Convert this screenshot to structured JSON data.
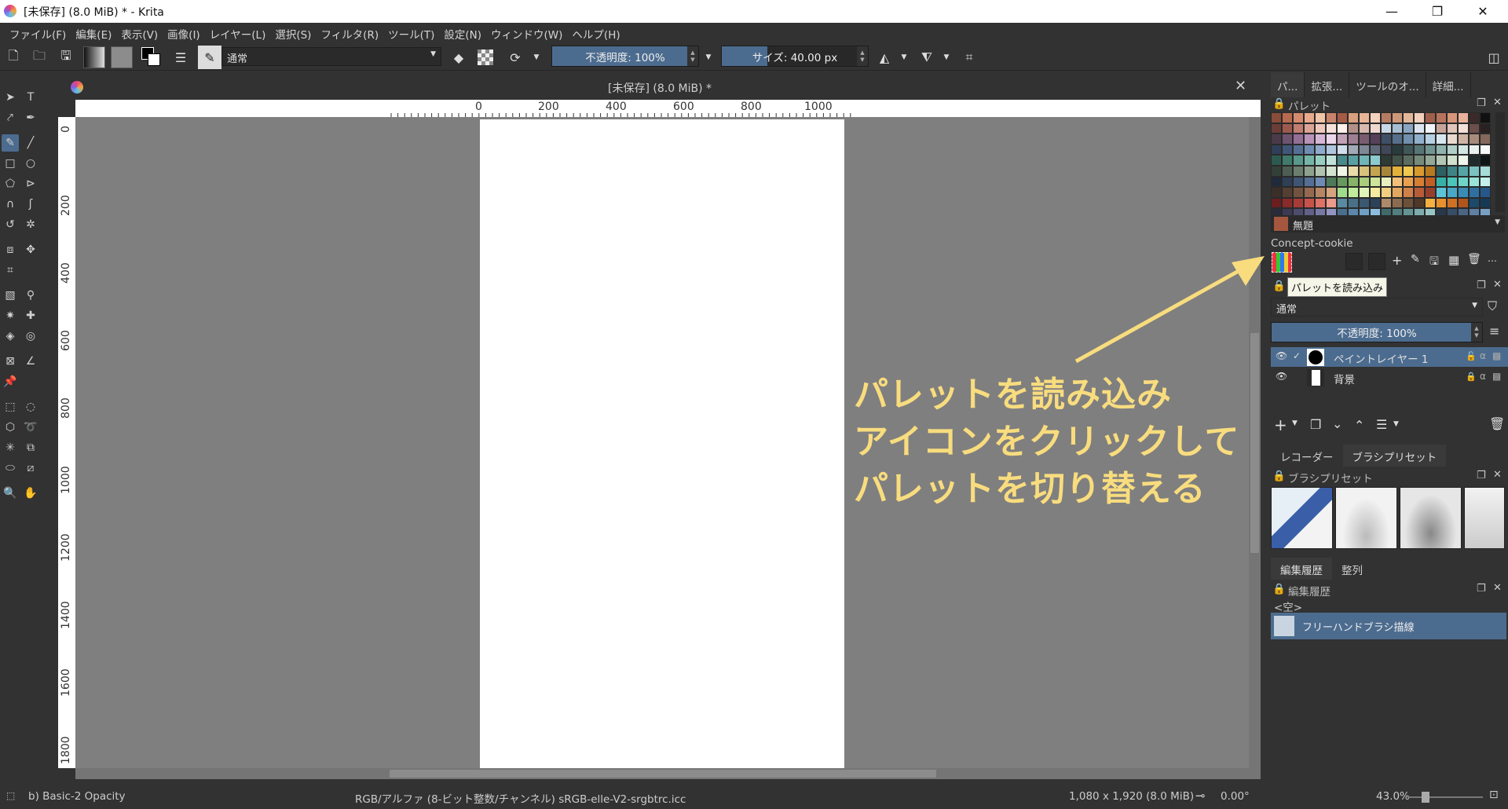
{
  "window": {
    "title": "[未保存]  (8.0 MiB) * - Krita",
    "minimize": "—",
    "maximize": "❐",
    "close": "✕"
  },
  "menu": [
    "ファイル(F)",
    "編集(E)",
    "表示(V)",
    "画像(I)",
    "レイヤー(L)",
    "選択(S)",
    "フィルタ(R)",
    "ツール(T)",
    "設定(N)",
    "ウィンドウ(W)",
    "ヘルプ(H)"
  ],
  "toolbar": {
    "blend_mode": "通常",
    "opacity": "不透明度: 100%",
    "size": "サイズ: 40.00 px"
  },
  "document": {
    "tab_title": "[未保存]  (8.0 MiB) *",
    "close": "✕"
  },
  "ruler": {
    "top": [
      "0",
      "200",
      "400",
      "600",
      "800",
      "1000"
    ],
    "left": [
      "0",
      "200",
      "400",
      "600",
      "800",
      "1000",
      "1200",
      "1400",
      "1600",
      "1800"
    ]
  },
  "annotation": {
    "line1": "パレットを読み込み",
    "line2": "アイコンをクリックして",
    "line3": "パレットを切り替える",
    "color": "#f8dc7e"
  },
  "dock": {
    "tabs": [
      "パ...",
      "拡張...",
      "ツールのオ...",
      "詳細..."
    ],
    "palette": {
      "title": "パレット",
      "selected_color_name": "無題",
      "palette_name": "Concept-cookie",
      "tooltip": "パレットを読み込み"
    },
    "layers": {
      "blend_mode": "通常",
      "opacity": "不透明度:  100%",
      "items": [
        {
          "name": "ペイントレイヤー 1"
        },
        {
          "name": "背景"
        }
      ]
    },
    "lower_tabs": [
      "レコーダー",
      "ブラシプリセット"
    ],
    "brush_presets": {
      "title": "ブラシプリセット"
    },
    "history_tabs": [
      "編集履歴",
      "整列"
    ],
    "history": {
      "title": "編集履歴",
      "empty": "<空>",
      "item": "フリーハンドブラシ描線"
    }
  },
  "status": {
    "brush": "b) Basic-2 Opacity",
    "color_space": "RGB/アルファ (8-ビット整数/チャンネル)  sRGB-elle-V2-srgbtrc.icc",
    "dimensions": "1,080 x 1,920 (8.0 MiB)",
    "rotation": "0.00°",
    "zoom": "43.0%"
  }
}
